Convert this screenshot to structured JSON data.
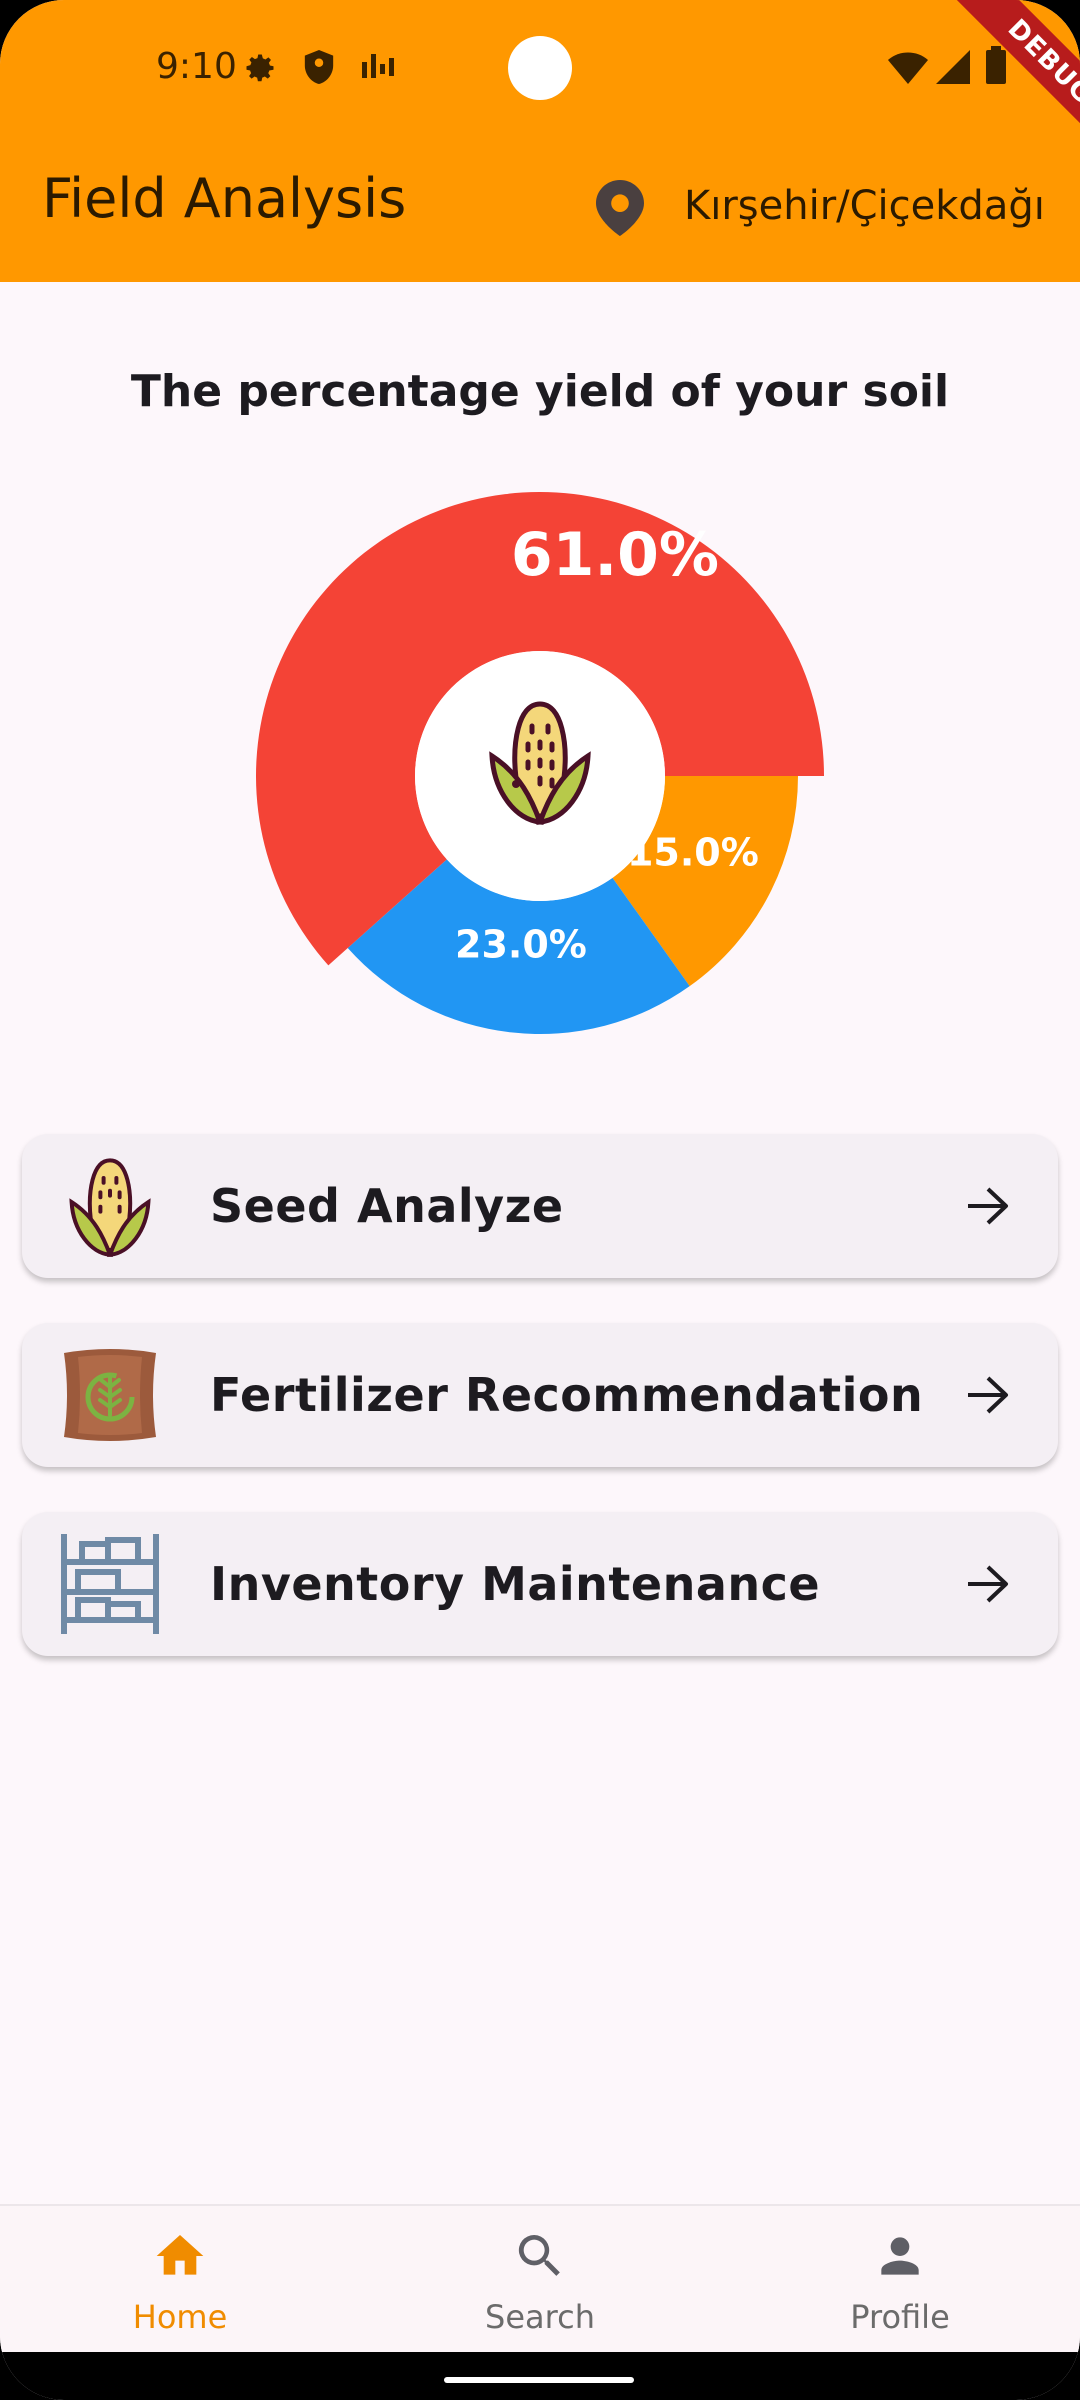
{
  "status_bar": {
    "time": "9:10",
    "debug_label": "DEBUG"
  },
  "header": {
    "title": "Field Analysis",
    "location": "Kırşehir/Çiçekdağı"
  },
  "chart_section": {
    "title": "The percentage yield of your soil"
  },
  "chart_data": {
    "type": "pie",
    "title": "The percentage yield of your soil",
    "slices": [
      {
        "label": "61.0%",
        "value": 61.0,
        "color": "#f44336"
      },
      {
        "label": "15.0%",
        "value": 15.0,
        "color": "#ff9800"
      },
      {
        "label": "23.0%",
        "value": 23.0,
        "color": "#2196f3"
      }
    ]
  },
  "menu": {
    "items": [
      {
        "label": "Seed Analyze",
        "icon": "corn-icon"
      },
      {
        "label": "Fertilizer Recommendation",
        "icon": "fertilizer-bag-icon"
      },
      {
        "label": "Inventory Maintenance",
        "icon": "shelf-icon"
      }
    ]
  },
  "bottom_nav": {
    "items": [
      {
        "label": "Home",
        "icon": "home-icon",
        "active": true
      },
      {
        "label": "Search",
        "icon": "search-icon",
        "active": false
      },
      {
        "label": "Profile",
        "icon": "profile-icon",
        "active": false
      }
    ]
  },
  "colors": {
    "accent": "#ff9800",
    "active_nav": "#f08c00"
  }
}
